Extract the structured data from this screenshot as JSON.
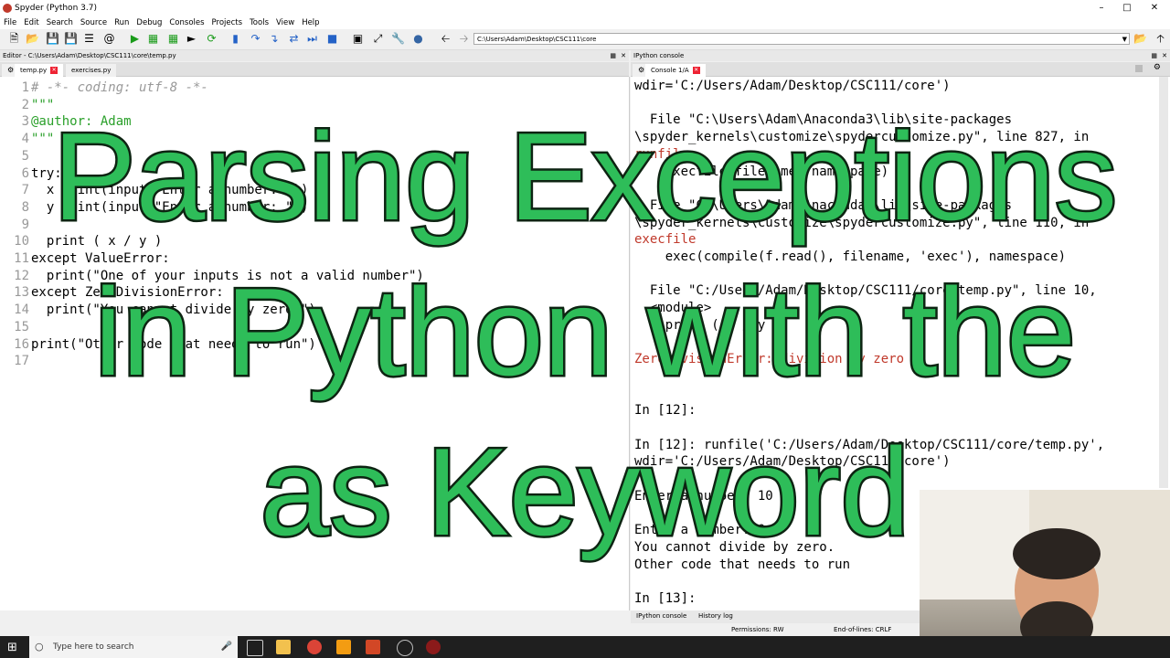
{
  "window": {
    "title": "Spyder (Python 3.7)"
  },
  "menu": [
    "File",
    "Edit",
    "Search",
    "Source",
    "Run",
    "Debug",
    "Consoles",
    "Projects",
    "Tools",
    "View",
    "Help"
  ],
  "toolbar": {
    "path": "C:\\Users\\Adam\\Desktop\\CSC111\\core"
  },
  "editor": {
    "header": "Editor - C:\\Users\\Adam\\Desktop\\CSC111\\core\\temp.py",
    "tabs": [
      "temp.py",
      "exercises.py"
    ],
    "lines": [
      {
        "n": "1",
        "text": "# -*- coding: utf-8 -*-"
      },
      {
        "n": "2",
        "text": "\"\"\""
      },
      {
        "n": "3",
        "text": "@author: Adam"
      },
      {
        "n": "4",
        "text": "\"\"\""
      },
      {
        "n": "5",
        "text": ""
      },
      {
        "n": "6",
        "text": "try:"
      },
      {
        "n": "7",
        "text": "  x = int(input(\"Enter a number: \"))"
      },
      {
        "n": "8",
        "text": "  y = int(input(\"Enter a number: \"))"
      },
      {
        "n": "9",
        "text": ""
      },
      {
        "n": "10",
        "text": "  print ( x / y )"
      },
      {
        "n": "11",
        "text": "except ValueError:"
      },
      {
        "n": "12",
        "text": "  print(\"One of your inputs is not a valid number\")"
      },
      {
        "n": "13",
        "text": "except ZeroDivisionError:"
      },
      {
        "n": "14",
        "text": "  print(\"You cannot divide by zero.\")"
      },
      {
        "n": "15",
        "text": ""
      },
      {
        "n": "16",
        "text": "print(\"Other code that needs to run\")"
      },
      {
        "n": "17",
        "text": ""
      }
    ]
  },
  "console": {
    "header": "IPython console",
    "tab": "Console 1/A",
    "lines": [
      "wdir='C:/Users/Adam/Desktop/CSC111/core')",
      "",
      "  File \"C:\\Users\\Adam\\Anaconda3\\lib\\site-packages",
      "\\spyder_kernels\\customize\\spydercustomize.py\", line 827, in",
      "runfile",
      "    execfile(filename, namespace)",
      "",
      "  File \"C:\\Users\\Adam\\Anaconda3\\lib\\site-packages",
      "\\spyder_kernels\\customize\\spydercustomize.py\", line 110, in",
      "execfile",
      "    exec(compile(f.read(), filename, 'exec'), namespace)",
      "",
      "  File \"C:/Users/Adam/Desktop/CSC111/core/temp.py\", line 10,",
      "  <module>",
      "    print ( x / y )",
      "",
      "ZeroDivisionError: division by zero",
      "",
      "",
      "In [12]:",
      "",
      "In [12]: runfile('C:/Users/Adam/Desktop/CSC111/core/temp.py',",
      "wdir='C:/Users/Adam/Desktop/CSC111/core')",
      "",
      "Enter a number: 10",
      "",
      "Enter a number: 0",
      "You cannot divide by zero.",
      "Other code that needs to run",
      "",
      "In [13]: "
    ]
  },
  "bottom_tabs": [
    "IPython console",
    "History log"
  ],
  "status": {
    "permissions": "Permissions: RW",
    "eol": "End-of-lines: CRLF"
  },
  "taskbar": {
    "search_placeholder": "Type here to search"
  },
  "overlay": {
    "line1": "Parsing Exceptions",
    "line2": "in Python with the",
    "line3": "as Keyword"
  }
}
